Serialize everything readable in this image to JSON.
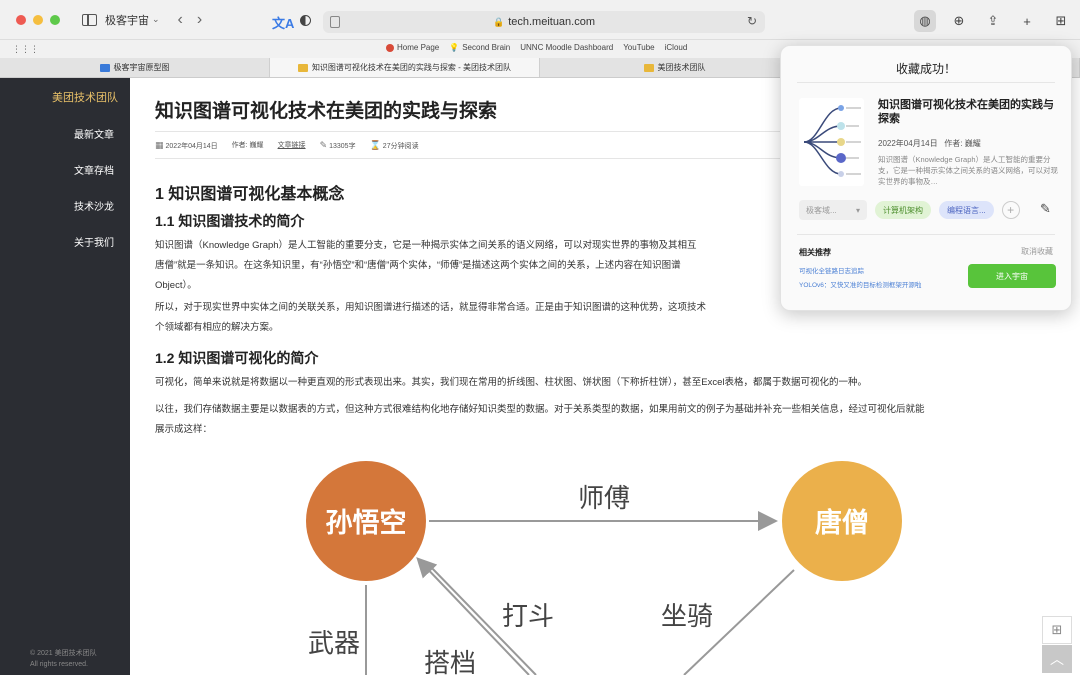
{
  "browser": {
    "tab_group": "极客宇宙",
    "url": "tech.meituan.com",
    "bookmarks": [
      "Home Page",
      "Second Brain",
      "UNNC Moodle Dashboard",
      "YouTube",
      "iCloud"
    ],
    "tabs": [
      "极客宇宙原型图",
      "知识图谱可视化技术在美团的实践与探索 - 美团技术团队",
      "美团技术团队"
    ]
  },
  "sidebar": {
    "brand": "美团技术团队",
    "items": [
      "最新文章",
      "文章存档",
      "技术沙龙",
      "关于我们"
    ],
    "footer_line1": "© 2021 美团技术团队",
    "footer_line2": "All rights reserved."
  },
  "article": {
    "title": "知识图谱可视化技术在美团的实践与探索",
    "meta": {
      "date": "2022年04月14日",
      "author": "作者: 巍耀",
      "link": "文章链接",
      "words": "13305字",
      "read_time": "27分钟阅读"
    },
    "h1": "1 知识图谱可视化基本概念",
    "h2_1": "1.1 知识图谱技术的简介",
    "p1_line1": "知识图谱（Knowledge Graph）是人工智能的重要分支，它是一种揭示实体之间关系的语义网络，可以对现实世界的事物及其相互",
    "p1_line2": "唐僧”就是一条知识。在这条知识里，有“孙悟空”和“唐僧”两个实体，“师傅”是描述这两个实体之间的关系，上述内容在知识图谱",
    "p1_line3": "Object）。",
    "p2_line1": "所以，对于现实世界中实体之间的关联关系，用知识图谱进行描述的话，就显得非常合适。正是由于知识图谱的这种优势，这项技术",
    "p2_line2": "个领域都有相应的解决方案。",
    "h2_2": "1.2 知识图谱可视化的简介",
    "p3": "可视化，简单来说就是将数据以一种更直观的形式表现出来。其实，我们现在常用的折线图、柱状图、饼状图（下称折柱饼），甚至Excel表格，都属于数据可视化的一种。",
    "p4_line1": "以往，我们存储数据主要是以数据表的方式，但这种方式很难结构化地存储好知识类型的数据。对于关系类型的数据，如果用前文的例子为基础并补充一些相关信息，经过可视化后就能",
    "p4_line2": "展示成这样："
  },
  "diagram": {
    "node_a": "孙悟空",
    "node_b": "唐僧",
    "edge_ab": "师傅",
    "edge_fight": "打斗",
    "edge_ride": "坐骑",
    "edge_weapon": "武器",
    "edge_partner": "搭档",
    "color_a": "#d4773a",
    "color_b": "#ebb04b"
  },
  "popup": {
    "title": "收藏成功！",
    "card_title": "知识图谱可视化技术在美团的实践与探索",
    "card_date": "2022年04月14日",
    "card_author": "作者: 巍耀",
    "card_desc": "知识图谱（Knowledge Graph）是人工智能的重要分支，它是一种揭示实体之间关系的语义网络，可以对现实世界的事物及…",
    "select_placeholder": "极客域...",
    "tag1": "计算机架构",
    "tag2": "编程语言...",
    "rec_label": "相关推荐",
    "cancel": "取消收藏",
    "rec1": "可视化全链路日志追踪",
    "rec2": "YOLOv6：又快又准的目标检测框架开源啦",
    "enter_button": "进入宇宙",
    "accent": "#58c43b"
  }
}
